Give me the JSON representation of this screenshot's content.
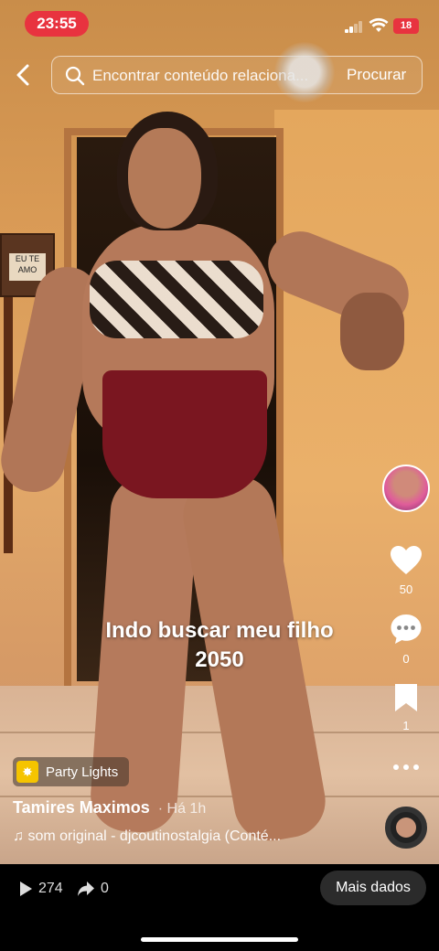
{
  "status_bar": {
    "time": "23:55",
    "battery": "18"
  },
  "search": {
    "placeholder": "Encontrar conteúdo relaciona...",
    "button_label": "Procurar"
  },
  "caption": {
    "line1": "Indo buscar meu filho",
    "line2": "2050"
  },
  "rail": {
    "likes": "50",
    "comments": "0",
    "saves": "1"
  },
  "effect": {
    "label": "Party Lights"
  },
  "author": {
    "name": "Tamires Maximos",
    "time_ago": "· Há 1h"
  },
  "sound": {
    "text": "som original - djcoutinostalgia (Conté..."
  },
  "bottom_bar": {
    "views": "274",
    "shares": "0",
    "more_label": "Mais dados"
  },
  "colors": {
    "time_pill": "#e8333f",
    "battery_low": "#e8333f",
    "effect_icon": "#f5c400"
  },
  "icons": [
    "back-arrow",
    "search",
    "heart",
    "comment",
    "bookmark",
    "more",
    "play",
    "share",
    "music-note",
    "sparkle"
  ]
}
